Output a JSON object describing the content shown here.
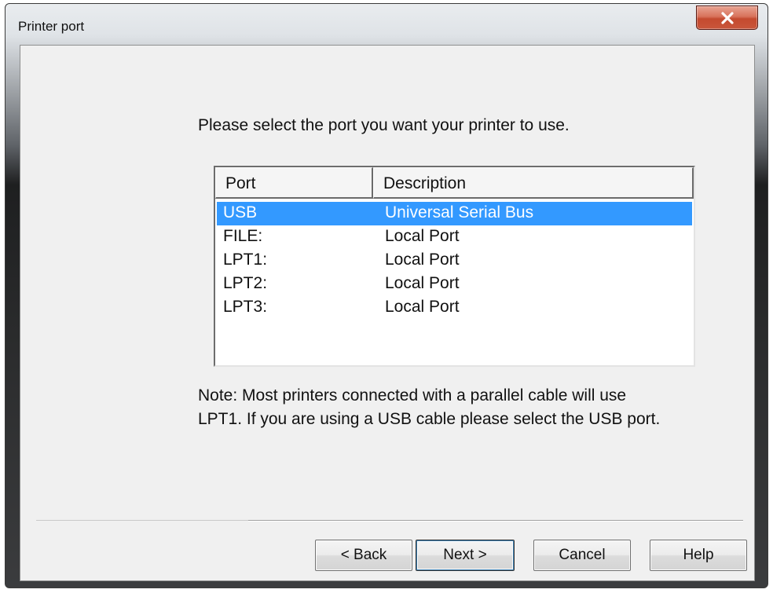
{
  "window": {
    "title": "Printer port"
  },
  "instruction": "Please select the port you want your printer to use.",
  "list": {
    "columns": [
      "Port",
      "Description"
    ],
    "rows": [
      {
        "port": "USB",
        "description": "Universal Serial Bus",
        "selected": true
      },
      {
        "port": "FILE:",
        "description": "Local Port"
      },
      {
        "port": "LPT1:",
        "description": "Local Port"
      },
      {
        "port": "LPT2:",
        "description": "Local Port"
      },
      {
        "port": "LPT3:",
        "description": "Local Port"
      }
    ]
  },
  "note": {
    "line1": "Note: Most printers connected with a parallel cable will use",
    "line2": "LPT1. If you are using a USB cable please select the USB port."
  },
  "buttons": {
    "back": "< Back",
    "next": "Next >",
    "cancel": "Cancel",
    "help": "Help"
  },
  "icons": {
    "close": "close-icon"
  },
  "colors": {
    "selection": "#3399ff",
    "close_button": "#c44a2f",
    "client_background": "#f0f0f0"
  }
}
